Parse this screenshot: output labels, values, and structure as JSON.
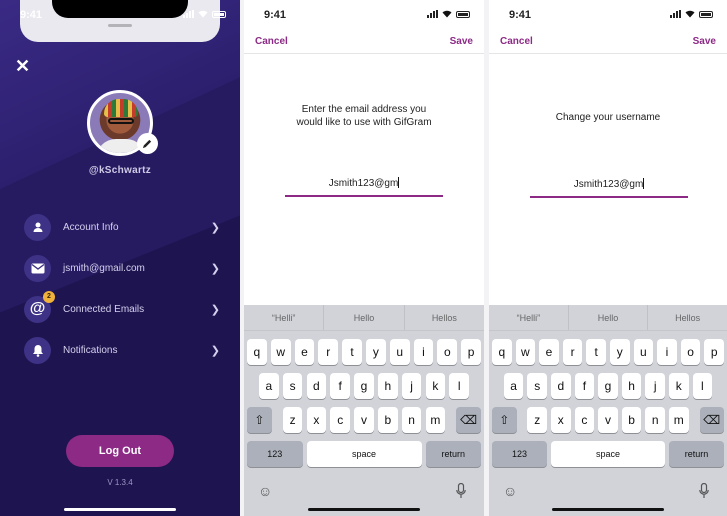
{
  "profile": {
    "status_time": "9:41",
    "username": "@kSchwartz",
    "menu": [
      {
        "label": "Account Info",
        "icon": "person-icon"
      },
      {
        "label": "jsmith@gmail.com",
        "icon": "envelope-icon"
      },
      {
        "label": "Connected Emails",
        "icon": "at-icon",
        "badge": "2"
      },
      {
        "label": "Notifications",
        "icon": "bell-icon"
      }
    ],
    "logout_label": "Log Out",
    "version": "V 1.3.4"
  },
  "email_screen": {
    "status_time": "9:41",
    "cancel": "Cancel",
    "save": "Save",
    "prompt_line1": "Enter the email address you",
    "prompt_line2": "would like to use with GifGram",
    "field_value": "Jsmith123@gm"
  },
  "username_screen": {
    "status_time": "9:41",
    "cancel": "Cancel",
    "save": "Save",
    "prompt": "Change your username",
    "field_value": "Jsmith123@gm"
  },
  "keyboard": {
    "suggestions": [
      "“Helli”",
      "Hello",
      "Hellos"
    ],
    "row1": [
      "q",
      "w",
      "e",
      "r",
      "t",
      "y",
      "u",
      "i",
      "o",
      "p"
    ],
    "row2": [
      "a",
      "s",
      "d",
      "f",
      "g",
      "h",
      "j",
      "k",
      "l"
    ],
    "row3": [
      "z",
      "x",
      "c",
      "v",
      "b",
      "n",
      "m"
    ],
    "numbers": "123",
    "space": "space",
    "return": "return"
  },
  "colors": {
    "accent": "#8c2a86",
    "profile_bg": "#1e1450",
    "badge": "#f0b23a"
  }
}
